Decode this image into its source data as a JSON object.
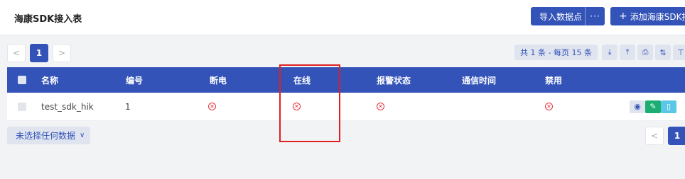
{
  "header": {
    "title": "海康SDK接入表",
    "import_label": "导入数据点",
    "more_label": "···",
    "add_label": "添加海康SDK接"
  },
  "pagination": {
    "prev": "<",
    "next": ">",
    "current_page": "1",
    "summary": "共 1 条 - 每页 15 条"
  },
  "tools": {
    "download": "⤓",
    "upload": "⤒",
    "print": "⎙",
    "sort": "⇅",
    "extra": "⊤"
  },
  "table": {
    "columns": [
      "名称",
      "编号",
      "断电",
      "在线",
      "报警状态",
      "通信时间",
      "禁用"
    ],
    "rows": [
      {
        "name": "test_sdk_hik",
        "number": "1",
        "power_off": "⊗",
        "online": "⊗",
        "alarm": "⊗",
        "comm_time": "",
        "disabled": "⊗"
      }
    ]
  },
  "row_actions": {
    "view": "👁",
    "edit": "✎",
    "delete": "🗑"
  },
  "footer": {
    "selection_label": "未选择任何数据",
    "selection_arrow": "∨",
    "page_prev": "<",
    "page_current": "1"
  },
  "colors": {
    "primary": "#3353b8",
    "danger": "#e0333f",
    "success": "#1aae72",
    "info": "#5bc7e6"
  }
}
